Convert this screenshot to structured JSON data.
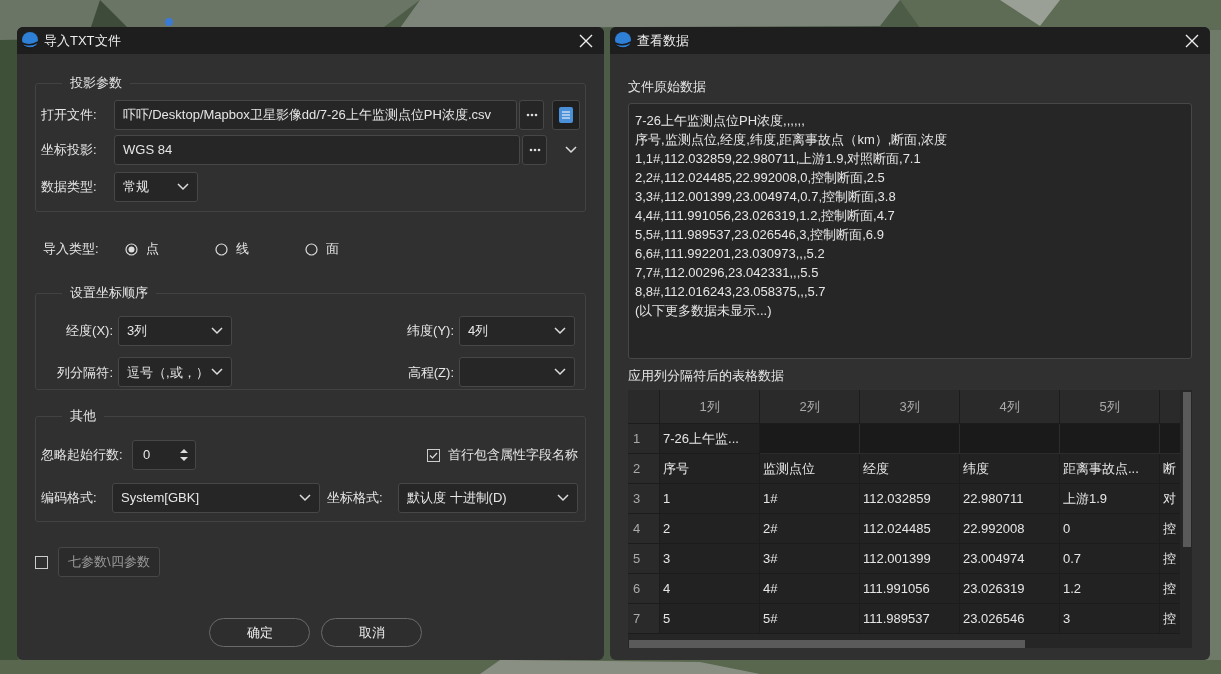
{
  "import_dialog": {
    "title": "导入TXT文件",
    "projection": {
      "title": "投影参数",
      "open_file": {
        "label": "打开文件:",
        "value": "吓吓/Desktop/Mapbox卫星影像dd/7-26上午监测点位PH浓度.csv"
      },
      "crs": {
        "label": "坐标投影:",
        "value": "WGS 84"
      },
      "data_type": {
        "label": "数据类型:",
        "value": "常规"
      }
    },
    "import_type": {
      "label": "导入类型:",
      "options": [
        {
          "label": "点",
          "selected": true
        },
        {
          "label": "线",
          "selected": false
        },
        {
          "label": "面",
          "selected": false
        }
      ]
    },
    "coord_order": {
      "title": "设置坐标顺序",
      "fields": [
        {
          "label": "经度(X):",
          "value": "3列"
        },
        {
          "label": "纬度(Y):",
          "value": "4列"
        },
        {
          "label": "列分隔符:",
          "value": "逗号（,或，）"
        },
        {
          "label": "高程(Z):"
        }
      ]
    },
    "other": {
      "title": "其他",
      "skip_rows": {
        "label": "忽略起始行数:",
        "value": "0"
      },
      "header_row": {
        "label": "首行包含属性字段名称",
        "checked": true
      },
      "encoding": {
        "label": "编码格式:",
        "value": "System[GBK]"
      },
      "coord_format": {
        "label": "坐标格式:",
        "value": "默认度 十进制(D)"
      }
    },
    "seven_param": {
      "checked": false,
      "button": "七参数\\四参数",
      "disabled": true
    },
    "buttons": [
      "确定",
      "取消"
    ]
  },
  "data_viewer": {
    "title": "查看数据",
    "raw_label": "文件原始数据",
    "raw_lines": [
      "7-26上午监测点位PH浓度,,,,,,",
      "序号,监测点位,经度,纬度,距离事故点（km）,断面,浓度",
      "1,1#,112.032859,22.980711,上游1.9,对照断面,7.1",
      "2,2#,112.024485,22.992008,0,控制断面,2.5",
      "3,3#,112.001399,23.004974,0.7,控制断面,3.8",
      "4,4#,111.991056,23.026319,1.2,控制断面,4.7",
      "5,5#,111.989537,23.026546,3,控制断面,6.9",
      "6,6#,111.992201,23.030973,,,5.2",
      "7,7#,112.00296,23.042331,,,5.5",
      "8,8#,112.016243,23.058375,,,5.7",
      "(以下更多数据未显示...)"
    ],
    "table_label": "应用列分隔符后的表格数据",
    "table": {
      "columns": [
        "1列",
        "2列",
        "3列",
        "4列",
        "5列"
      ],
      "rows": [
        {
          "number": "1",
          "cells": [
            "7-26上午监...",
            "",
            "",
            "",
            "",
            ""
          ]
        },
        {
          "number": "2",
          "cells": [
            "序号",
            "监测点位",
            "经度",
            "纬度",
            "距离事故点...",
            "断"
          ]
        },
        {
          "number": "3",
          "cells": [
            "1",
            "1#",
            "112.032859",
            "22.980711",
            "上游1.9",
            "对"
          ]
        },
        {
          "number": "4",
          "cells": [
            "2",
            "2#",
            "112.024485",
            "22.992008",
            "0",
            "控"
          ]
        },
        {
          "number": "5",
          "cells": [
            "3",
            "3#",
            "112.001399",
            "23.004974",
            "0.7",
            "控"
          ]
        },
        {
          "number": "6",
          "cells": [
            "4",
            "4#",
            "111.991056",
            "23.026319",
            "1.2",
            "控"
          ]
        },
        {
          "number": "7",
          "cells": [
            "5",
            "5#",
            "111.989537",
            "23.026546",
            "3",
            "控"
          ]
        }
      ]
    }
  }
}
